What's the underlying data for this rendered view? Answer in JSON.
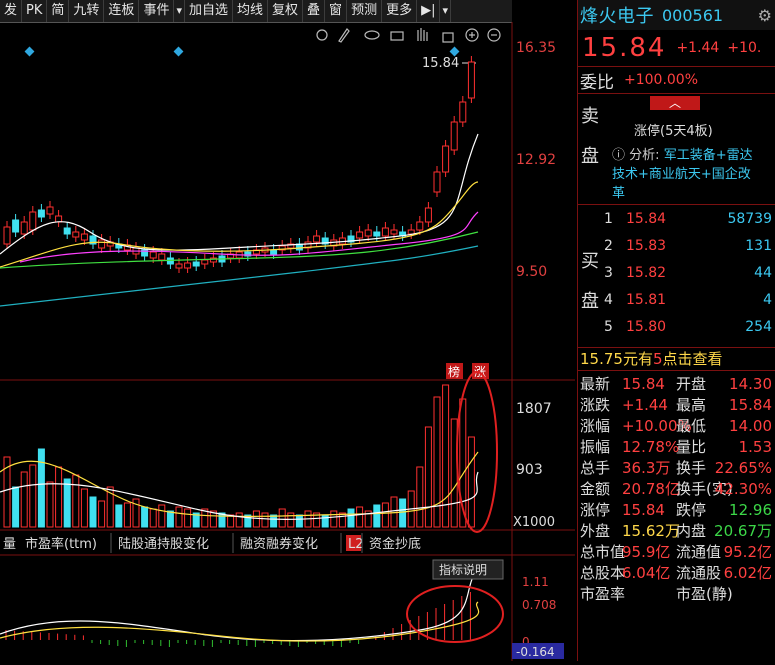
{
  "toolbar": {
    "items": [
      "发",
      "PK",
      "简",
      "九转",
      "连板",
      "事件",
      "▾",
      "加自选",
      "均线",
      "复权",
      "叠",
      "窗",
      "预测",
      "更多",
      "▶|",
      "▾"
    ]
  },
  "chart_tools": {
    "icons": [
      "settings-icon",
      "pen-icon",
      "eye-icon",
      "basket-icon",
      "hand-icon",
      "lock-icon",
      "zoom-in-icon",
      "zoom-out-icon"
    ]
  },
  "kline": {
    "price_axis": [
      "16.35",
      "12.92",
      "9.50"
    ],
    "last_price_label": "15.84",
    "badges": [
      "榜",
      "涨"
    ],
    "colors": {
      "up": "#ff3030",
      "down": "#40e0f0",
      "ma5": "#ffffff",
      "ma10": "#ffe040",
      "ma20": "#ff40ff",
      "ma30": "#40e040",
      "ma60": "#20b0c0"
    }
  },
  "volume": {
    "axis": [
      "1807",
      "903",
      "X1000"
    ]
  },
  "indicator_tabs": [
    "量",
    "市盈率(ttm)",
    "陆股通持股变化",
    "融资融券变化",
    "L2",
    "资金抄底"
  ],
  "macd": {
    "button": "指标说明",
    "axis": [
      "1.11",
      "0.708",
      "0",
      "-0.164"
    ]
  },
  "stock": {
    "name": "烽火电子",
    "code": "000561",
    "price": "15.84",
    "change": "+1.44",
    "pct": "+10."
  },
  "webi": {
    "label": "委比",
    "value": "+100.00%"
  },
  "sell_panel": {
    "side": [
      "卖",
      "盘"
    ],
    "limit_up": "涨停(5天4板)",
    "analysis_label": "分析:",
    "analysis": "军工装备+雷达技术+商业航天+国企改革"
  },
  "buy_panel": {
    "side": [
      "买",
      "盘"
    ],
    "rows": [
      {
        "level": "1",
        "price": "15.84",
        "vol": "58739"
      },
      {
        "level": "2",
        "price": "15.83",
        "vol": "131"
      },
      {
        "level": "3",
        "price": "15.82",
        "vol": "44"
      },
      {
        "level": "4",
        "price": "15.81",
        "vol": "4"
      },
      {
        "level": "5",
        "price": "15.80",
        "vol": "254"
      }
    ]
  },
  "ad_banner": {
    "prefix": "15.75元有",
    "num": "5",
    "link": "点击查看"
  },
  "stats": [
    {
      "l1": "最新",
      "v1": "15.84",
      "l2": "开盘",
      "v2": "14.30"
    },
    {
      "l1": "涨跌",
      "v1": "+1.44",
      "l2": "最高",
      "v2": "15.84"
    },
    {
      "l1": "涨幅",
      "v1": "+10.00%",
      "l2": "最低",
      "v2": "14.00"
    },
    {
      "l1": "振幅",
      "v1": "12.78%",
      "l2": "量比",
      "v2": "1.53"
    },
    {
      "l1": "总手",
      "v1": "36.3万",
      "l2": "换手",
      "v2": "22.65%"
    },
    {
      "l1": "金额",
      "v1": "20.78亿",
      "l2": "换手(实)",
      "v2": "42.30%"
    },
    {
      "l1": "涨停",
      "v1": "15.84",
      "l2": "跌停",
      "v2": "12.96"
    },
    {
      "l1": "外盘",
      "v1": "15.62万",
      "l2": "内盘",
      "v2": "20.67万"
    },
    {
      "l1": "总市值",
      "v1": "95.9亿",
      "l2": "流通值",
      "v2": "95.2亿"
    },
    {
      "l1": "总股本",
      "v1": "6.04亿",
      "l2": "流通股",
      "v2": "6.02亿"
    },
    {
      "l1": "市盈率",
      "v1": "",
      "l2": "市盈(静)",
      "v2": ""
    }
  ]
}
